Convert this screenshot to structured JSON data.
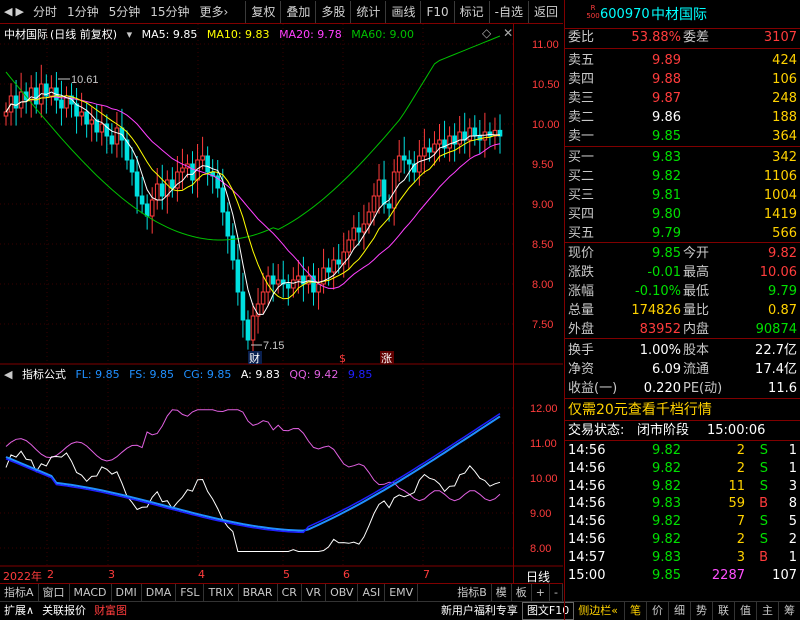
{
  "toolbar": {
    "left": [
      "分时",
      "1分钟",
      "5分钟",
      "15分钟",
      "更多"
    ],
    "right": [
      "复权",
      "叠加",
      "多股",
      "统计",
      "画线",
      "F10",
      "标记",
      "-自选",
      "返回"
    ]
  },
  "main_chart": {
    "title_name": "中材国际",
    "title_mode": "(日线 前复权)",
    "ma5": "MA5: 9.85",
    "ma10": "MA10: 9.83",
    "ma20": "MA20: 9.78",
    "ma60": "MA60: 9.00",
    "y_ticks": [
      "11.00",
      "10.50",
      "10.00",
      "9.50",
      "9.00",
      "8.50",
      "8.00",
      "7.50"
    ],
    "high_label": "10.61",
    "low_label": "7.15",
    "markers": [
      "财",
      "$",
      "涨"
    ]
  },
  "indicator": {
    "title": "指标公式",
    "fl": "FL: 9.85",
    "fs": "FS: 9.85",
    "cg": "CG: 9.85",
    "a": "A: 9.83",
    "qq": "QQ: 9.42",
    "last": "9.85",
    "y_ticks": [
      "12.00",
      "11.00",
      "10.00",
      "9.00",
      "8.00"
    ]
  },
  "xaxis": {
    "year": "2022年",
    "months": [
      "2",
      "3",
      "4",
      "5",
      "6",
      "7"
    ],
    "period": "日线"
  },
  "tabs": [
    "指标A",
    "窗口",
    "MACD",
    "DMI",
    "DMA",
    "FSL",
    "TRIX",
    "BRAR",
    "CR",
    "VR",
    "OBV",
    "ASI",
    "EMV",
    "指标B",
    "模",
    "板",
    "+",
    "-"
  ],
  "status": [
    "扩展∧",
    "关联报价",
    "财富图",
    "新用户福利专享",
    "图文F10",
    "侧边栏«"
  ],
  "stock": {
    "code": "600970",
    "name": "中材国际",
    "badge_top": "R",
    "badge_bot": "500"
  },
  "weibi": {
    "label1": "委比",
    "val1": "53.88%",
    "label2": "委差",
    "val2": "3107"
  },
  "sells": [
    {
      "label": "卖五",
      "price": "9.89",
      "vol": "424"
    },
    {
      "label": "卖四",
      "price": "9.88",
      "vol": "106"
    },
    {
      "label": "卖三",
      "price": "9.87",
      "vol": "248"
    },
    {
      "label": "卖二",
      "price": "9.86",
      "vol": "188"
    },
    {
      "label": "卖一",
      "price": "9.85",
      "vol": "364"
    }
  ],
  "buys": [
    {
      "label": "买一",
      "price": "9.83",
      "vol": "342"
    },
    {
      "label": "买二",
      "price": "9.82",
      "vol": "1106"
    },
    {
      "label": "买三",
      "price": "9.81",
      "vol": "1004"
    },
    {
      "label": "买四",
      "price": "9.80",
      "vol": "1419"
    },
    {
      "label": "买五",
      "price": "9.79",
      "vol": "566"
    }
  ],
  "quote": [
    {
      "l1": "现价",
      "v1": "9.85",
      "l2": "今开",
      "v2": "9.82"
    },
    {
      "l1": "涨跌",
      "v1": "-0.01",
      "l2": "最高",
      "v2": "10.06"
    },
    {
      "l1": "涨幅",
      "v1": "-0.10%",
      "l2": "最低",
      "v2": "9.79"
    },
    {
      "l1": "总量",
      "v1": "174826",
      "l2": "量比",
      "v2": "0.87"
    },
    {
      "l1": "外盘",
      "v1": "83952",
      "l2": "内盘",
      "v2": "90874"
    }
  ],
  "fund": [
    {
      "l1": "换手",
      "v1": "1.00%",
      "l2": "股本",
      "v2": "22.7亿"
    },
    {
      "l1": "净资",
      "v1": "6.09",
      "l2": "流通",
      "v2": "17.4亿"
    },
    {
      "l1": "收益(一)",
      "v1": "0.220",
      "l2": "PE(动)",
      "v2": "11.6"
    }
  ],
  "promo": "仅需20元查看千档行情",
  "trade_status_label": "交易状态:",
  "trade_status": "闭市阶段",
  "trade_time": "15:00:06",
  "ticks": [
    {
      "t": "14:56",
      "p": "9.82",
      "v": "2",
      "d": "S",
      "n": "1"
    },
    {
      "t": "14:56",
      "p": "9.82",
      "v": "2",
      "d": "S",
      "n": "1"
    },
    {
      "t": "14:56",
      "p": "9.82",
      "v": "11",
      "d": "S",
      "n": "3"
    },
    {
      "t": "14:56",
      "p": "9.83",
      "v": "59",
      "d": "B",
      "n": "8"
    },
    {
      "t": "14:56",
      "p": "9.82",
      "v": "7",
      "d": "S",
      "n": "5"
    },
    {
      "t": "14:56",
      "p": "9.82",
      "v": "2",
      "d": "S",
      "n": "2"
    },
    {
      "t": "14:57",
      "p": "9.83",
      "v": "3",
      "d": "B",
      "n": "1"
    },
    {
      "t": "15:00",
      "p": "9.85",
      "v": "2287",
      "d": "",
      "n": "107"
    }
  ],
  "side_buttons": [
    "笔",
    "价",
    "细",
    "势",
    "联",
    "值",
    "主",
    "筹"
  ],
  "colors": {
    "up": "#ff3c3c",
    "down": "#00e000",
    "ma5": "#ffffff",
    "ma10": "#ffff00",
    "ma20": "#ff40ff",
    "ma60": "#00c000",
    "frame": "#800000"
  }
}
